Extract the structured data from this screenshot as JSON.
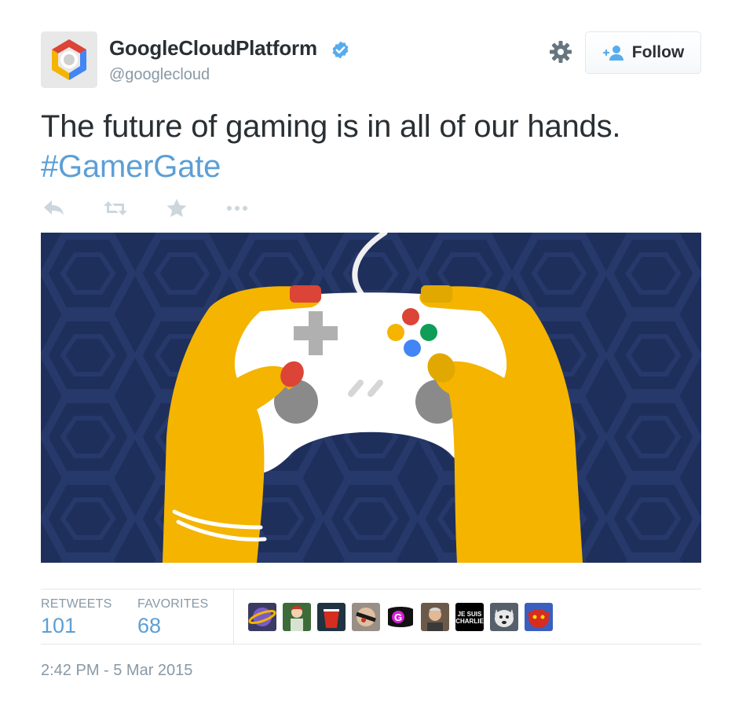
{
  "author": {
    "display_name": "GoogleCloudPlatform",
    "handle": "@googlecloud",
    "verified": true,
    "avatar": "google-cloud-hexagon-logo"
  },
  "header": {
    "settings_icon": "gear-icon",
    "follow_label": "Follow",
    "follow_icon": "add-user-icon"
  },
  "tweet": {
    "text": "The future of gaming is in all of our hands.",
    "hashtag": "#GamerGate"
  },
  "actions": [
    {
      "name": "reply",
      "icon": "reply-icon"
    },
    {
      "name": "retweet",
      "icon": "retweet-icon"
    },
    {
      "name": "favorite",
      "icon": "star-icon"
    },
    {
      "name": "more",
      "icon": "more-dots-icon"
    }
  ],
  "media": {
    "description_icon": "hands-holding-game-controller-illustration"
  },
  "stats": {
    "retweets_label": "RETWEETS",
    "retweets_count": "101",
    "favorites_label": "FAVORITES",
    "favorites_count": "68"
  },
  "favoriters": [
    {
      "icon": "planet-avatar"
    },
    {
      "icon": "anime-character-avatar"
    },
    {
      "icon": "red-cup-avatar"
    },
    {
      "icon": "masked-face-avatar"
    },
    {
      "icon": "gamergate-logo-avatar",
      "text": "G"
    },
    {
      "icon": "man-portrait-avatar"
    },
    {
      "icon": "je-suis-charlie-avatar",
      "text": "JE SUIS CHARLIE"
    },
    {
      "icon": "dog-avatar"
    },
    {
      "icon": "red-creature-avatar"
    }
  ],
  "timestamp": "2:42 PM - 5 Mar 2015",
  "colors": {
    "link": "#5b9fd6",
    "muted": "#8899a6",
    "text": "#292f33",
    "verified": "#55acee",
    "media_bg": "#1e2f5c",
    "hand": "#f4b400",
    "nail": "#db4437"
  }
}
